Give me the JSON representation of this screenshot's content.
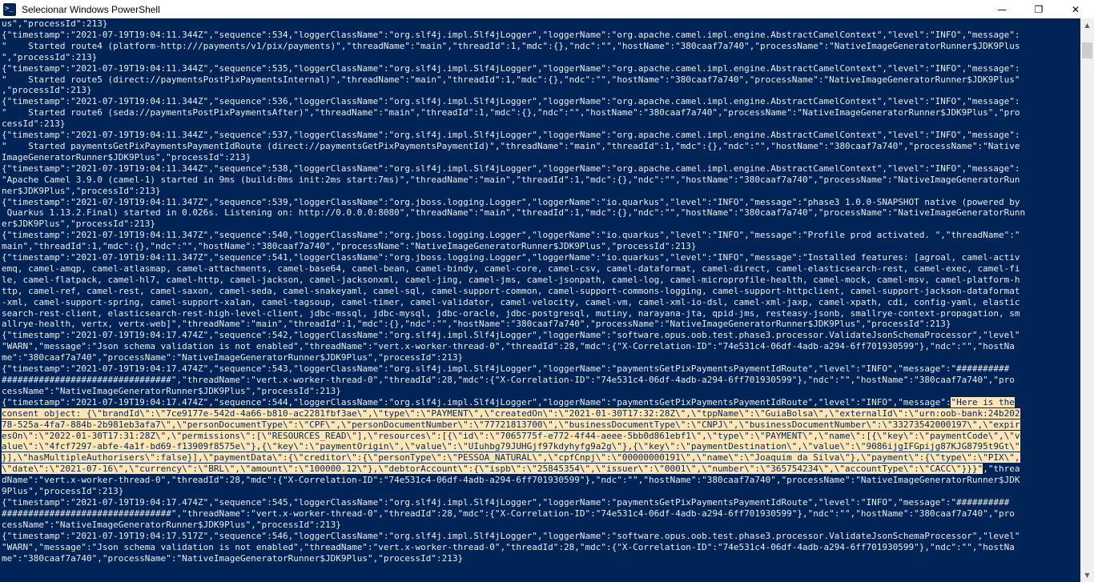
{
  "window": {
    "title": "Selecionar Windows PowerShell",
    "minimize_glyph": "—",
    "maximize_glyph": "❐",
    "close_glyph": "✕"
  },
  "scrollbar": {
    "up_glyph": "▲",
    "down_glyph": "▼"
  },
  "console": {
    "pre_selection": "us\",\"processId\":213}\n{\"timestamp\":\"2021-07-19T19:04:11.344Z\",\"sequence\":534,\"loggerClassName\":\"org.slf4j.impl.Slf4jLogger\",\"loggerName\":\"org.apache.camel.impl.engine.AbstractCamelContext\",\"level\":\"INFO\",\"message\":\n\"    Started route4 (platform-http:///payments/v1/pix/payments)\",\"threadName\":\"main\",\"threadId\":1,\"mdc\":{},\"ndc\":\"\",\"hostName\":\"380caaf7a740\",\"processName\":\"NativeImageGeneratorRunner$JDK9Plus\n\",\"processId\":213}\n{\"timestamp\":\"2021-07-19T19:04:11.344Z\",\"sequence\":535,\"loggerClassName\":\"org.slf4j.impl.Slf4jLogger\",\"loggerName\":\"org.apache.camel.impl.engine.AbstractCamelContext\",\"level\":\"INFO\",\"message\":\n\"    Started route5 (direct://paymentsPostPixPaymentsInternal)\",\"threadName\":\"main\",\"threadId\":1,\"mdc\":{},\"ndc\":\"\",\"hostName\":\"380caaf7a740\",\"processName\":\"NativeImageGeneratorRunner$JDK9Plus\"\n,\"processId\":213}\n{\"timestamp\":\"2021-07-19T19:04:11.344Z\",\"sequence\":536,\"loggerClassName\":\"org.slf4j.impl.Slf4jLogger\",\"loggerName\":\"org.apache.camel.impl.engine.AbstractCamelContext\",\"level\":\"INFO\",\"message\":\n\"    Started route6 (seda://paymentsPostPixPaymentsAfter)\",\"threadName\":\"main\",\"threadId\":1,\"mdc\":{},\"ndc\":\"\",\"hostName\":\"380caaf7a740\",\"processName\":\"NativeImageGeneratorRunner$JDK9Plus\",\"pro\ncessId\":213}\n{\"timestamp\":\"2021-07-19T19:04:11.344Z\",\"sequence\":537,\"loggerClassName\":\"org.slf4j.impl.Slf4jLogger\",\"loggerName\":\"org.apache.camel.impl.engine.AbstractCamelContext\",\"level\":\"INFO\",\"message\":\n\"    Started paymentsGetPixPaymentsPaymentIdRoute (direct://paymentsGetPixPaymentsPaymentId)\",\"threadName\":\"main\",\"threadId\":1,\"mdc\":{},\"ndc\":\"\",\"hostName\":\"380caaf7a740\",\"processName\":\"Native\nImageGeneratorRunner$JDK9Plus\",\"processId\":213}\n{\"timestamp\":\"2021-07-19T19:04:11.344Z\",\"sequence\":538,\"loggerClassName\":\"org.slf4j.impl.Slf4jLogger\",\"loggerName\":\"org.apache.camel.impl.engine.AbstractCamelContext\",\"level\":\"INFO\",\"message\":\n\"Apache Camel 3.9.0 (camel-1) started in 9ms (build:0ms init:2ms start:7ms)\",\"threadName\":\"main\",\"threadId\":1,\"mdc\":{},\"ndc\":\"\",\"hostName\":\"380caaf7a740\",\"processName\":\"NativeImageGeneratorRun\nner$JDK9Plus\",\"processId\":213}\n{\"timestamp\":\"2021-07-19T19:04:11.347Z\",\"sequence\":539,\"loggerClassName\":\"org.jboss.logging.Logger\",\"loggerName\":\"io.quarkus\",\"level\":\"INFO\",\"message\":\"phase3 1.0.0-SNAPSHOT native (powered by\n Quarkus 1.13.2.Final) started in 0.026s. Listening on: http://0.0.0.0:8080\",\"threadName\":\"main\",\"threadId\":1,\"mdc\":{},\"ndc\":\"\",\"hostName\":\"380caaf7a740\",\"processName\":\"NativeImageGeneratorRunn\ner$JDK9Plus\",\"processId\":213}\n{\"timestamp\":\"2021-07-19T19:04:11.347Z\",\"sequence\":540,\"loggerClassName\":\"org.jboss.logging.Logger\",\"loggerName\":\"io.quarkus\",\"level\":\"INFO\",\"message\":\"Profile prod activated. \",\"threadName\":\"\nmain\",\"threadId\":1,\"mdc\":{},\"ndc\":\"\",\"hostName\":\"380caaf7a740\",\"processName\":\"NativeImageGeneratorRunner$JDK9Plus\",\"processId\":213}\n{\"timestamp\":\"2021-07-19T19:04:11.347Z\",\"sequence\":541,\"loggerClassName\":\"org.jboss.logging.Logger\",\"loggerName\":\"io.quarkus\",\"level\":\"INFO\",\"message\":\"Installed features: [agroal, camel-activ\nemq, camel-amqp, camel-atlasmap, camel-attachments, camel-base64, camel-bean, camel-bindy, camel-core, camel-csv, camel-dataformat, camel-direct, camel-elasticsearch-rest, camel-exec, camel-fi\nle, camel-flatpack, camel-hl7, camel-http, camel-jackson, camel-jacksonxml, camel-jing, camel-jms, camel-jsonpath, camel-log, camel-microprofile-health, camel-mock, camel-msv, camel-platform-h\nttp, camel-ref, camel-rest, camel-saxon, camel-seda, camel-snakeyaml, camel-sql, camel-support-common, camel-support-commons-logging, camel-support-httpclient, camel-support-jackson-dataformat\n-xml, camel-support-spring, camel-support-xalan, camel-tagsoup, camel-timer, camel-validator, camel-velocity, camel-vm, camel-xml-io-dsl, camel-xml-jaxp, camel-xpath, cdi, config-yaml, elastic\nsearch-rest-client, elasticsearch-rest-high-level-client, jdbc-mssql, jdbc-mysql, jdbc-oracle, jdbc-postgresql, mutiny, narayana-jta, qpid-jms, resteasy-jsonb, smallrye-context-propagation, sm\nallrye-health, vertx, vertx-web]\",\"threadName\":\"main\",\"threadId\":1,\"mdc\":{},\"ndc\":\"\",\"hostName\":\"380caaf7a740\",\"processName\":\"NativeImageGeneratorRunner$JDK9Plus\",\"processId\":213}\n{\"timestamp\":\"2021-07-19T19:04:17.474Z\",\"sequence\":542,\"loggerClassName\":\"org.slf4j.impl.Slf4jLogger\",\"loggerName\":\"software.opus.oob.test.phase3.processor.ValidateJsonSchemaProcessor\",\"level\"\n\"WARN\",\"message\":\"Json schema validation is not enabled\",\"threadName\":\"vert.x-worker-thread-0\",\"threadId\":28,\"mdc\":{\"X-Correlation-ID\":\"74e531c4-06df-4adb-a294-6ff701930599\"},\"ndc\":\"\",\"hostNa\nme\":\"380caaf7a740\",\"processName\":\"NativeImageGeneratorRunner$JDK9Plus\",\"processId\":213}\n{\"timestamp\":\"2021-07-19T19:04:17.474Z\",\"sequence\":543,\"loggerClassName\":\"org.slf4j.impl.Slf4jLogger\",\"loggerName\":\"paymentsGetPixPaymentsPaymentIdRoute\",\"level\":\"INFO\",\"message\":\"##########\n################################\",\"threadName\":\"vert.x-worker-thread-0\",\"threadId\":28,\"mdc\":{\"X-Correlation-ID\":\"74e531c4-06df-4adb-a294-6ff701930599\"},\"ndc\":\"\",\"hostName\":\"380caaf7a740\",\"pro\ncessName\":\"NativeImageGeneratorRunner$JDK9Plus\",\"processId\":213}\n{\"timestamp\":\"2021-07-19T19:04:17.474Z\",\"sequence\":544,\"loggerClassName\":\"org.slf4j.impl.Slf4jLogger\",\"loggerName\":\"paymentsGetPixPaymentsPaymentIdRoute\",\"level\":\"INFO\",\"message\":",
    "selection": "\"Here is the\nconsent object: {\\\"brandId\\\":\\\"7ce9177e-542d-4a66-b810-ac2281fbf3ae\\\",\\\"type\\\":\\\"PAYMENT\\\",\\\"createdOn\\\":\\\"2021-01-30T17:32:28Z\\\",\\\"tppName\\\":\\\"GuiaBolsa\\\",\\\"externalId\\\":\\\"urn:oob-bank:24b202\n78-525a-4fa7-884b-2b981eb3afa7\\\",\\\"personDocumentType\\\":\\\"CPF\\\",\\\"personDocumentNumber\\\":\\\"77721813700\\\",\\\"businessDocumentType\\\":\\\"CNPJ\\\",\\\"businessDocumentNumber\\\":\\\"33273542000197\\\",\\\"expir\nesOn\\\":\\\"2022-01-30T17:31:28Z\\\",\\\"permissions\\\":[\\\"RESOURCES_READ\\\"],\\\"resources\\\":[{\\\"id\\\":\\\"7065775f-e772-4f44-aeee-5bb0d861ebf1\\\",\\\"type\\\":\\\"PAYMENT\\\",\\\"name\\\":[{\\\"key\\\":\\\"paymentCode\\\",\\\"v\nalue\\\":\\\"4fcf7297-abfe-4a1f-bd69-f13909f8575e\\\"},{\\\"key\\\":\\\"paymentOrigin\\\",\\\"value\\\":\\\"UIuhbg79JUHGjf97kdyhyfg9a2g\\\"},{\\\"key\\\":\\\"paymentDestination\\\",\\\"value\\\":\\\"9086ijgIFGpijg87KJG8795t9Gt\\\"\n}],\\\"hasMultipleAuthorisers\\\":false}],\\\"paymentData\\\":{\\\"creditor\\\":{\\\"personType\\\":\\\"PESSOA_NATURAL\\\",\\\"cpfCnpj\\\":\\\"00000000191\\\",\\\"name\\\":\\\"Joaquim da Silva\\\"},\\\"payment\\\":{\\\"type\\\":\\\"PIX\\\",\n\\\"date\\\":\\\"2021-07-16\\\",\\\"currency\\\":\\\"BRL\\\",\\\"amount\\\":\\\"100000.12\\\"},\\\"debtorAccount\\\":{\\\"ispb\\\":\\\"25845354\\\",\\\"issuer\\\":\\\"0001\\\",\\\"number\\\":\\\"365754234\\\",\\\"accountType\\\":\\\"CACC\\\"}}}\"",
    "post_selection": ",\"threa\ndName\":\"vert.x-worker-thread-0\",\"threadId\":28,\"mdc\":{\"X-Correlation-ID\":\"74e531c4-06df-4adb-a294-6ff701930599\"},\"ndc\":\"\",\"hostName\":\"380caaf7a740\",\"processName\":\"NativeImageGeneratorRunner$JDK\n9Plus\",\"processId\":213}\n{\"timestamp\":\"2021-07-19T19:04:17.474Z\",\"sequence\":545,\"loggerClassName\":\"org.slf4j.impl.Slf4jLogger\",\"loggerName\":\"paymentsGetPixPaymentsPaymentIdRoute\",\"level\":\"INFO\",\"message\":\"##########\n################################\",\"threadName\":\"vert.x-worker-thread-0\",\"threadId\":28,\"mdc\":{\"X-Correlation-ID\":\"74e531c4-06df-4adb-a294-6ff701930599\"},\"ndc\":\"\",\"hostName\":\"380caaf7a740\",\"pro\ncessName\":\"NativeImageGeneratorRunner$JDK9Plus\",\"processId\":213}\n{\"timestamp\":\"2021-07-19T19:04:17.517Z\",\"sequence\":546,\"loggerClassName\":\"org.slf4j.impl.Slf4jLogger\",\"loggerName\":\"software.opus.oob.test.phase3.processor.ValidateJsonSchemaProcessor\",\"level\"\n\"WARN\",\"message\":\"Json schema validation is not enabled\",\"threadName\":\"vert.x-worker-thread-0\",\"threadId\":28,\"mdc\":{\"X-Correlation-ID\":\"74e531c4-06df-4adb-a294-6ff701930599\"},\"ndc\":\"\",\"hostNa\nme\":\"380caaf7a740\",\"processName\":\"NativeImageGeneratorRunner$JDK9Plus\",\"processId\":213}"
  }
}
